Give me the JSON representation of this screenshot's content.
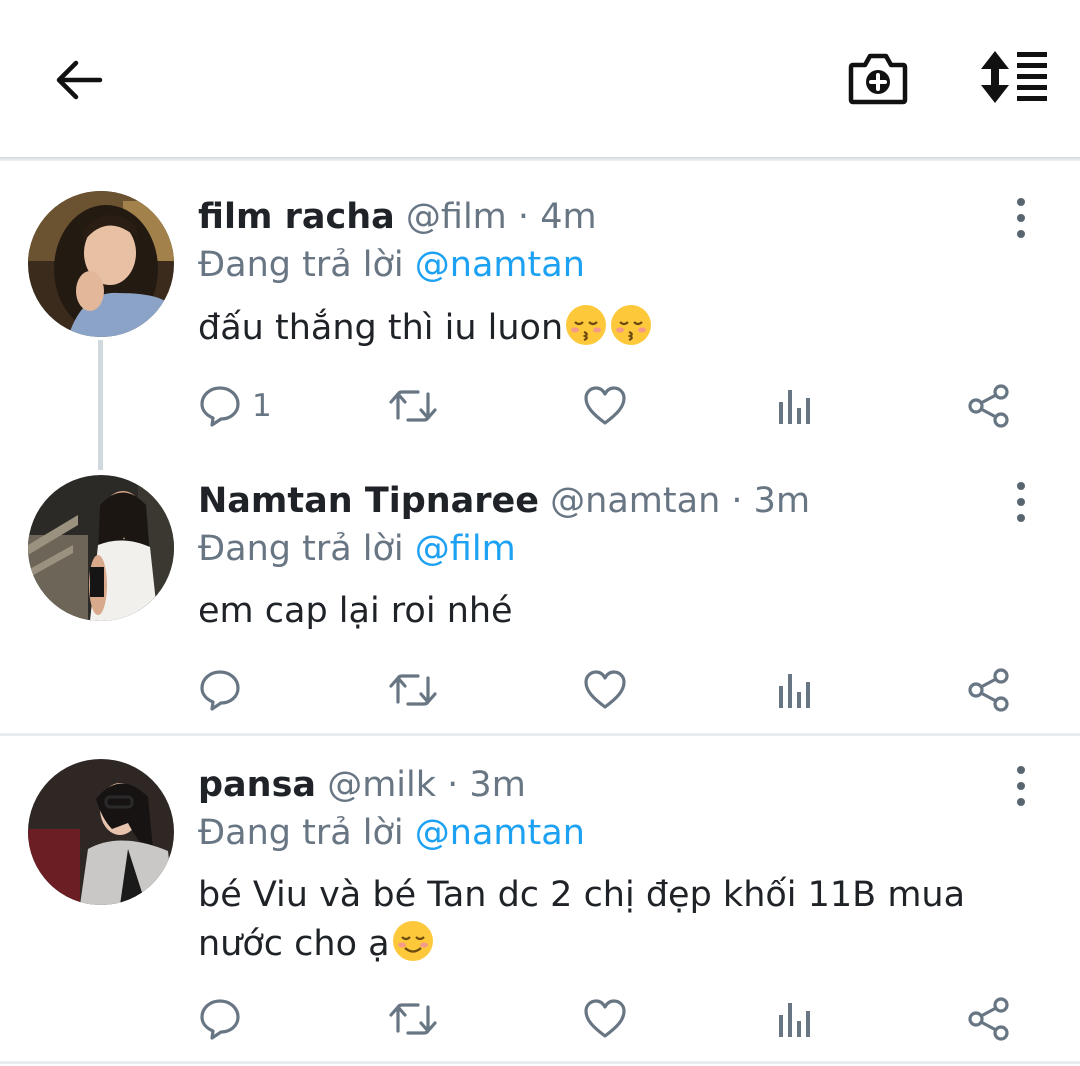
{
  "header": {
    "back_icon": "arrow-left-icon",
    "camera_icon": "camera-plus-icon",
    "sort_icon": "sort-list-icon"
  },
  "tweets": [
    {
      "name": "film racha",
      "handle": "@film",
      "separator": "·",
      "time": "4m",
      "reply_prefix": "Đang trả lời",
      "reply_to": "@namtan",
      "text": "đấu thắng thì iu luon",
      "emojis": [
        "kissing-closed-eyes",
        "kissing-closed-eyes"
      ],
      "reply_count": "1"
    },
    {
      "name": "Namtan Tipnaree",
      "handle": "@namtan",
      "separator": "·",
      "time": "3m",
      "reply_prefix": "Đang trả lời",
      "reply_to": "@film",
      "text": "em cap lại roi nhé",
      "emojis": [],
      "reply_count": ""
    },
    {
      "name": "pansa",
      "handle": "@milk",
      "separator": "·",
      "time": "3m",
      "reply_prefix": "Đang trả lời",
      "reply_to": "@namtan",
      "text_line1": "bé Viu và bé Tan dc 2 chị đẹp khối 11B mua",
      "text_line2": "nước cho ạ",
      "emojis": [
        "smiling-face"
      ],
      "reply_count": ""
    }
  ],
  "colors": {
    "accent": "#1da1f2",
    "secondary_text": "#687684",
    "primary_text": "#1f2328",
    "icon": "#687684"
  }
}
